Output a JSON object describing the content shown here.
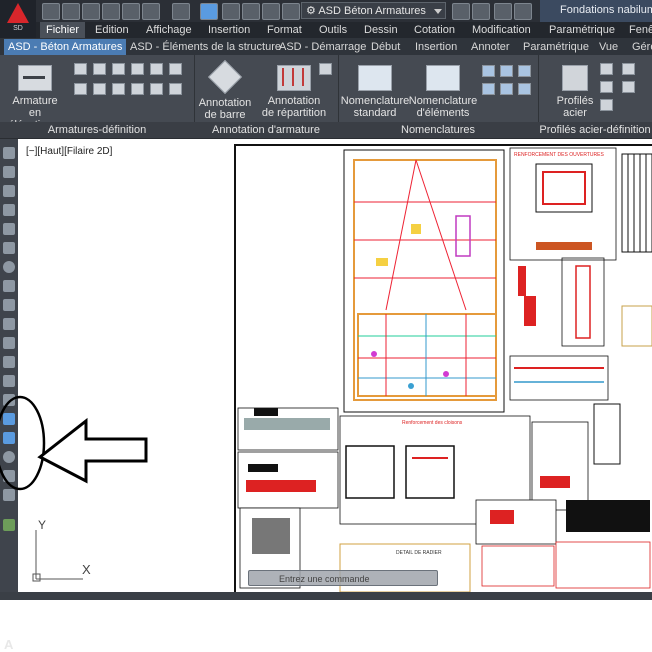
{
  "app": {
    "logo_subtext": "SD",
    "workspace": "ASD Béton Armatures",
    "document_title": "Fondations nabilum"
  },
  "menubar": [
    "Fichier",
    "Edition",
    "Affichage",
    "Insertion",
    "Format",
    "Outils",
    "Dessin",
    "Cotation",
    "Modification",
    "Paramétrique",
    "Fenêt"
  ],
  "ribbon_tabs": [
    "ASD - Béton Armatures",
    "ASD - Éléments de la structure",
    "ASD - Démarrage",
    "Début",
    "Insertion",
    "Annoter",
    "Paramétrique",
    "Vue",
    "Gére"
  ],
  "ribbon": {
    "panel1": {
      "title": "Armatures-définition",
      "big_button_line1": "Armature",
      "big_button_line2": "en élévation..."
    },
    "panel2": {
      "title": "Annotation d'armature",
      "btn1_line1": "Annotation",
      "btn1_line2": "de barre",
      "btn2_line1": "Annotation",
      "btn2_line2": "de répartition"
    },
    "panel3": {
      "title": "Nomenclatures",
      "btn1_line1": "Nomenclature",
      "btn1_line2": "standard",
      "btn2_line1": "Nomenclature",
      "btn2_line2": "d'éléments"
    },
    "panel4": {
      "title": "Profilés acier-définition",
      "btn1_line1": "Profilés",
      "btn1_line2": "acier"
    }
  },
  "drawing": {
    "viewport_label": "[−][Haut][Filaire 2D]",
    "ucs_y": "Y",
    "ucs_x": "X",
    "titles": {
      "ouvertures": "RENFORCEMENT DES OUVERTURES",
      "cloisons": "Renforcement des cloisons",
      "radier": "DETAIL DE RADIER"
    },
    "command_placeholder": "Entrez une commande"
  },
  "left_toolbar": {
    "text_tool_label": "A"
  },
  "colors": {
    "ribbon_bg": "#454a52",
    "active_tab": "#4b7cb3",
    "logo_red": "#d8262b",
    "annotation_black": "#000000"
  }
}
